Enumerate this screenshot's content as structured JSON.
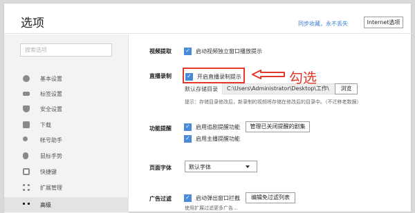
{
  "header": {
    "title": "选项",
    "sync_link": "同步收藏，永不丢失",
    "internet_button": "Internet选项"
  },
  "sidebar": {
    "search_placeholder": "搜索选项",
    "items": [
      {
        "label": "基本设置",
        "icon": "sun-gear-icon"
      },
      {
        "label": "标签设置",
        "icon": "tab-icon"
      },
      {
        "label": "安全设置",
        "icon": "shield-icon"
      },
      {
        "label": "下载",
        "icon": "download-icon"
      },
      {
        "label": "帐号助手",
        "icon": "key-icon"
      },
      {
        "label": "鼠标手势",
        "icon": "mouse-icon"
      },
      {
        "label": "快捷键",
        "icon": "shortcut-icon"
      },
      {
        "label": "扩展管理",
        "icon": "grid-icon"
      },
      {
        "label": "高级",
        "icon": "more-dots-icon"
      }
    ],
    "active_index": 8
  },
  "content": {
    "video_extract": {
      "section": "视频提取",
      "option": "启动视频独立窗口播放提示"
    },
    "live_record": {
      "section": "直播录制",
      "option": "开启直播录制提示",
      "storage_label": "默认存储目录",
      "storage_path": "C:\\Users\\Administrator\\Desktop\\工作\\",
      "browse_button": "浏览",
      "hint": "提示：存储目录修改后，新录制的视频将存储在修改后的目录中。（不迁移老数据）"
    },
    "feature_remind": {
      "section": "功能提醒",
      "option1": "启用追剧提醒功能",
      "manage_button": "管理已关闭提醒的剧集",
      "option2": "启用主播提醒功能"
    },
    "page_font": {
      "section": "页面字体",
      "select_value": "默认字体"
    },
    "ad_filter": {
      "section": "广告过滤",
      "option": "启动弹出窗口拦截",
      "edit_button": "编辑免过滤列表",
      "hint": "使用扩展过滤更多广告..."
    }
  },
  "annotation": {
    "text": "勾选",
    "color": "#e3372b"
  },
  "colors": {
    "accent": "#4a8ad8",
    "annotation_red": "#e3372b",
    "sidebar_bg": "#f3f3f3"
  }
}
